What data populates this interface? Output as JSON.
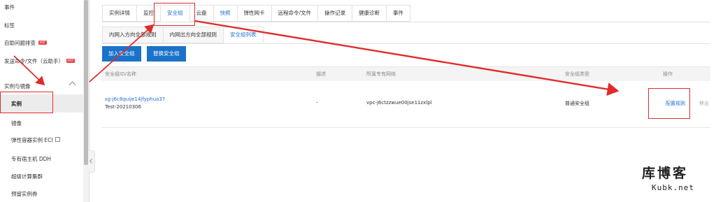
{
  "sidebar": {
    "items": [
      {
        "label": "事件"
      },
      {
        "label": "标签"
      },
      {
        "label": "自助问题排查",
        "badge": "HOT"
      },
      {
        "label": "发送命令/文件（云助手）",
        "badge": "HOT"
      },
      {
        "label": "实例与镜像"
      },
      {
        "label": "实例"
      },
      {
        "label": "镜像"
      },
      {
        "label": "弹性容器实例 ECI"
      },
      {
        "label": "专有宿主机 DDH"
      },
      {
        "label": "超级计算集群"
      },
      {
        "label": "预留实例券"
      }
    ]
  },
  "tabs": [
    {
      "label": "实例详情"
    },
    {
      "label": "监控"
    },
    {
      "label": "安全组"
    },
    {
      "label": "云盘"
    },
    {
      "label": "快照"
    },
    {
      "label": "弹性网卡"
    },
    {
      "label": "远程命令/文件"
    },
    {
      "label": "操作记录"
    },
    {
      "label": "健康诊断"
    },
    {
      "label": "事件"
    }
  ],
  "subtabs": [
    {
      "label": "内网入方向全部规则"
    },
    {
      "label": "内网出方向全部规则"
    },
    {
      "label": "安全组列表"
    }
  ],
  "buttons": {
    "join": "加入安全组",
    "replace": "替换安全组"
  },
  "table": {
    "headers": [
      "安全组ID/名称",
      "描述",
      "所属专有网络",
      "安全组类型",
      "操作"
    ],
    "row": {
      "id": "sg-j6c8quije14jfyphua37",
      "name": "Test-20210306",
      "desc": "-",
      "vpc": "vpc-j6ctzzwue00jse11zxlpl",
      "type": "普通安全组",
      "action_config": "配置规则",
      "action_remove": "移出"
    }
  },
  "watermark": {
    "cn": "库博客",
    "en": "Kubk.net"
  },
  "colors": {
    "accent": "#1a73c8",
    "link": "#1f6fd1",
    "annotation": "#e12b2b",
    "hot_badge": "#e64545"
  }
}
